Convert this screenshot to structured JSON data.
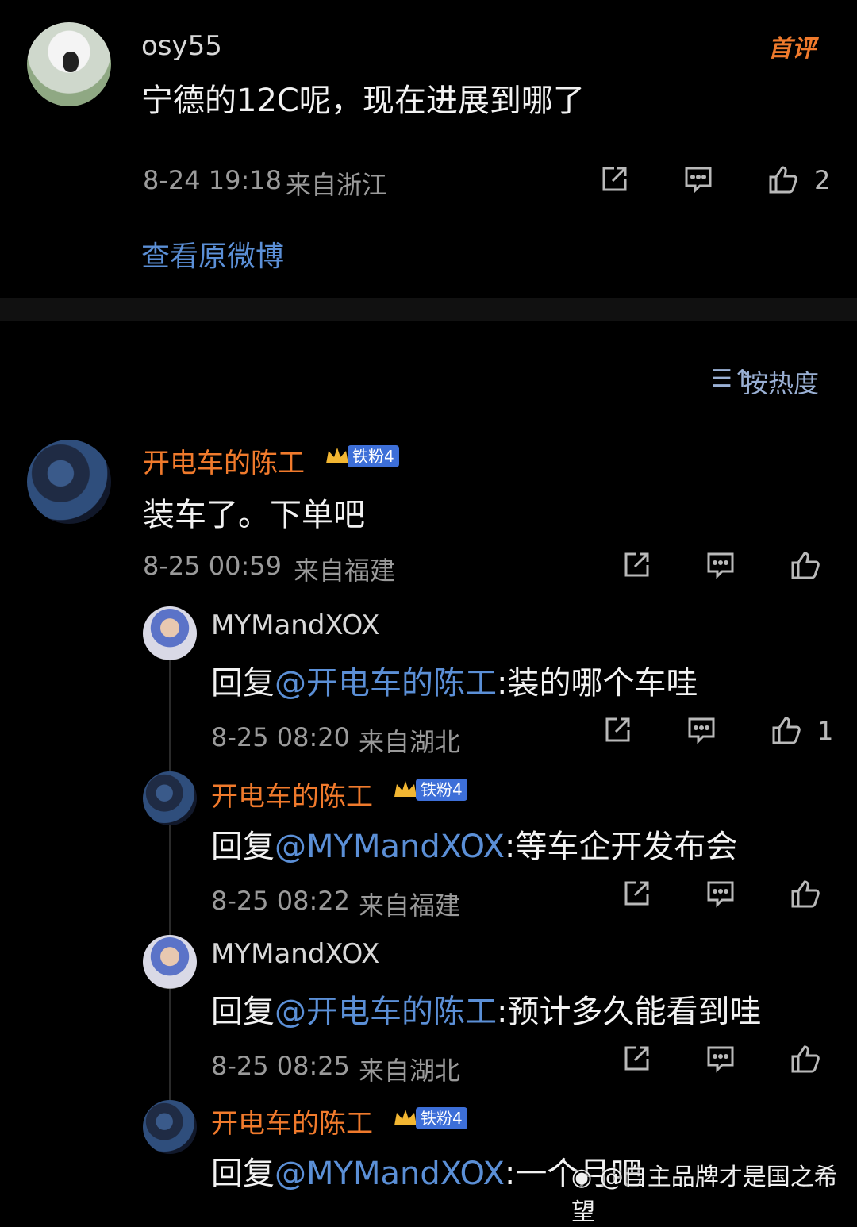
{
  "main_comment": {
    "username": "osy55",
    "badge": "首评",
    "text": "宁德的12C呢，现在进展到哪了",
    "time": "8-24 19:18",
    "location": "来自浙江",
    "like_count": "2",
    "view_original": "查看原微博"
  },
  "sort": {
    "icon": "sort-icon",
    "label": "按热度"
  },
  "top_comment": {
    "username": "开电车的陈工",
    "fan_badge": "铁粉4",
    "text": "装车了。下单吧",
    "time": "8-25 00:59",
    "location": "来自福建"
  },
  "replies": [
    {
      "username": "MYMandXOX",
      "prefix": "回复",
      "mention": "@开电车的陈工",
      "text": ":装的哪个车哇",
      "time": "8-25 08:20",
      "location": "来自湖北",
      "like_count": "1"
    },
    {
      "username": "开电车的陈工",
      "fan_badge": "铁粉4",
      "prefix": "回复",
      "mention": "@MYMandXOX",
      "text": ":等车企开发布会",
      "time": "8-25 08:22",
      "location": "来自福建"
    },
    {
      "username": "MYMandXOX",
      "prefix": "回复",
      "mention": "@开电车的陈工",
      "text": ":预计多久能看到哇",
      "time": "8-25 08:25",
      "location": "来自湖北"
    },
    {
      "username": "开电车的陈工",
      "fan_badge": "铁粉4",
      "prefix": "回复",
      "mention": "@MYMandXOX",
      "text": ":一个月吧"
    }
  ],
  "watermark": "@自主品牌才是国之希望",
  "colors": {
    "background": "#000000",
    "username_highlight": "#f07a2c",
    "link": "#5b8fd6",
    "badge": "#3d6fd8"
  }
}
